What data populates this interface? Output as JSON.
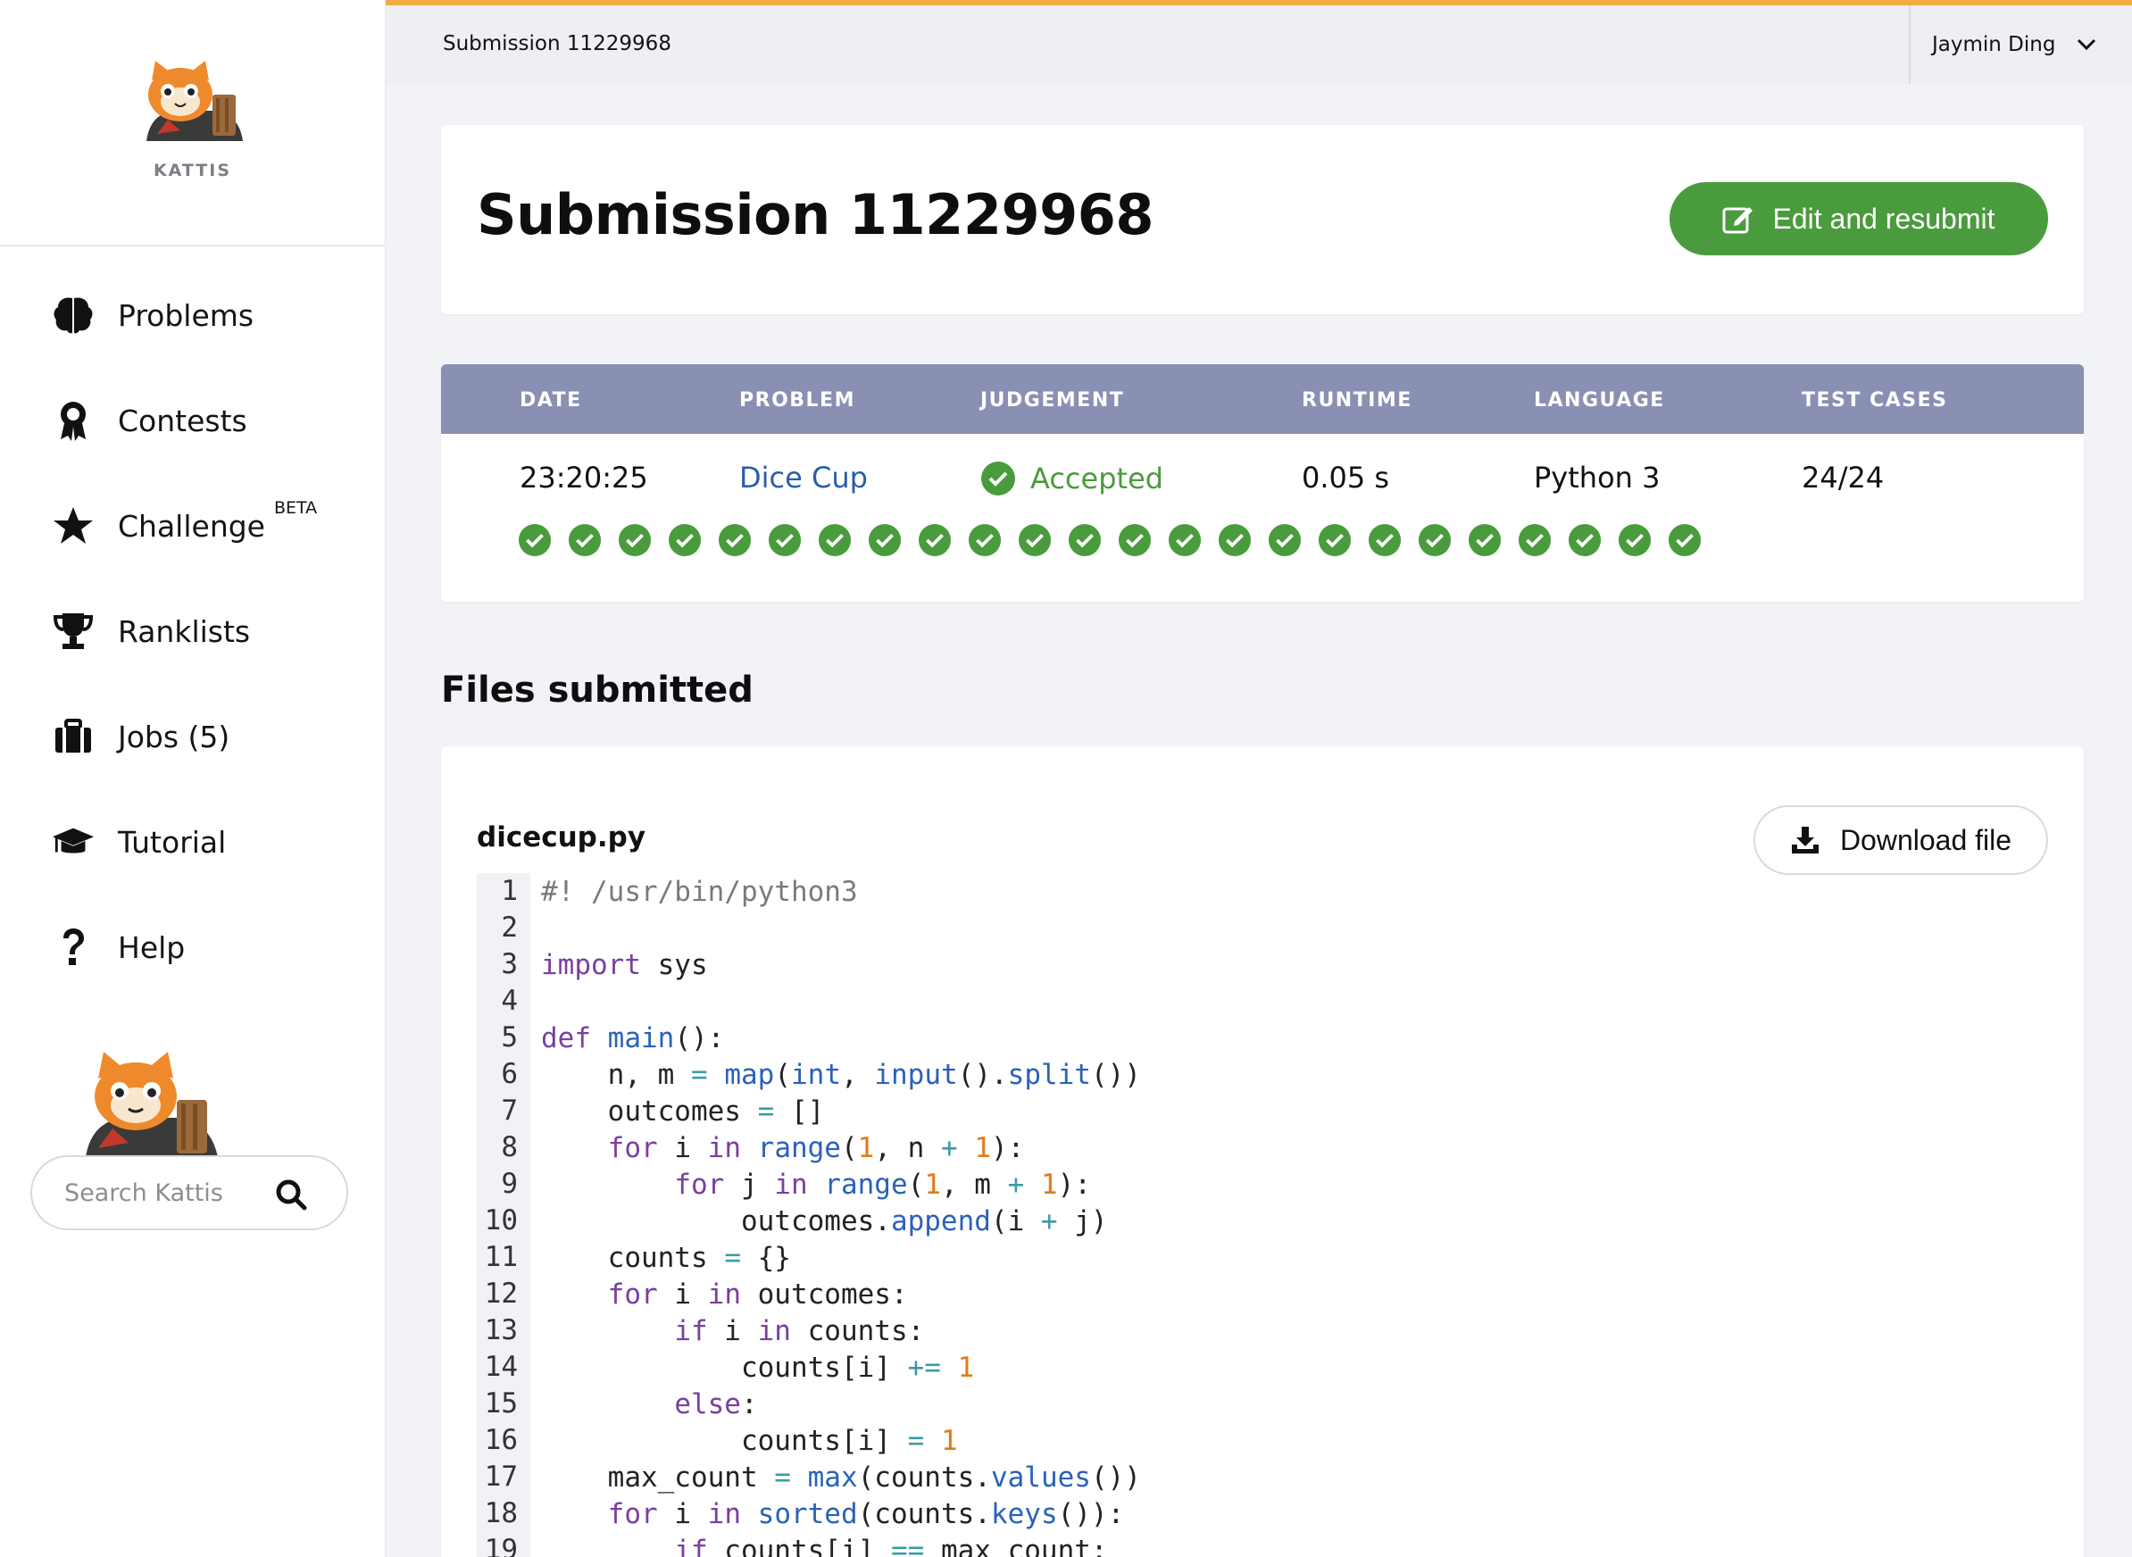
{
  "sidebar": {
    "logo_text": "KATTIS",
    "items": [
      {
        "label": "Problems",
        "icon": "brain-icon"
      },
      {
        "label": "Contests",
        "icon": "award-icon"
      },
      {
        "label": "Challenge",
        "icon": "star-icon",
        "badge": "BETA"
      },
      {
        "label": "Ranklists",
        "icon": "trophy-icon"
      },
      {
        "label": "Jobs (5)",
        "icon": "briefcase-icon"
      },
      {
        "label": "Tutorial",
        "icon": "graduation-cap-icon"
      },
      {
        "label": "Help",
        "icon": "question-icon"
      }
    ],
    "search_placeholder": "Search Kattis"
  },
  "topbar": {
    "title": "Submission 11229968",
    "user": "Jaymin Ding"
  },
  "header": {
    "title": "Submission 11229968",
    "resubmit_label": "Edit and resubmit"
  },
  "results": {
    "columns": [
      "DATE",
      "PROBLEM",
      "JUDGEMENT",
      "RUNTIME",
      "LANGUAGE",
      "TEST CASES"
    ],
    "date": "23:20:25",
    "problem": "Dice Cup",
    "judgement": "Accepted",
    "runtime": "0.05 s",
    "language": "Python 3",
    "test_cases": "24/24",
    "tests_passed": 24
  },
  "files": {
    "section_title": "Files submitted",
    "file_name": "dicecup.py",
    "download_label": "Download file",
    "code_lines": [
      "#! /usr/bin/python3",
      "",
      "import sys",
      "",
      "def main():",
      "    n, m = map(int, input().split())",
      "    outcomes = []",
      "    for i in range(1, n + 1):",
      "        for j in range(1, m + 1):",
      "            outcomes.append(i + j)",
      "    counts = {}",
      "    for i in outcomes:",
      "        if i in counts:",
      "            counts[i] += 1",
      "        else:",
      "            counts[i] = 1",
      "    max_count = max(counts.values())",
      "    for i in sorted(counts.keys()):",
      "        if counts[i] == max_count:"
    ]
  },
  "colors": {
    "accent_green": "#4a9b3d",
    "table_header": "#8a90b3",
    "top_border": "#f0ad45"
  }
}
